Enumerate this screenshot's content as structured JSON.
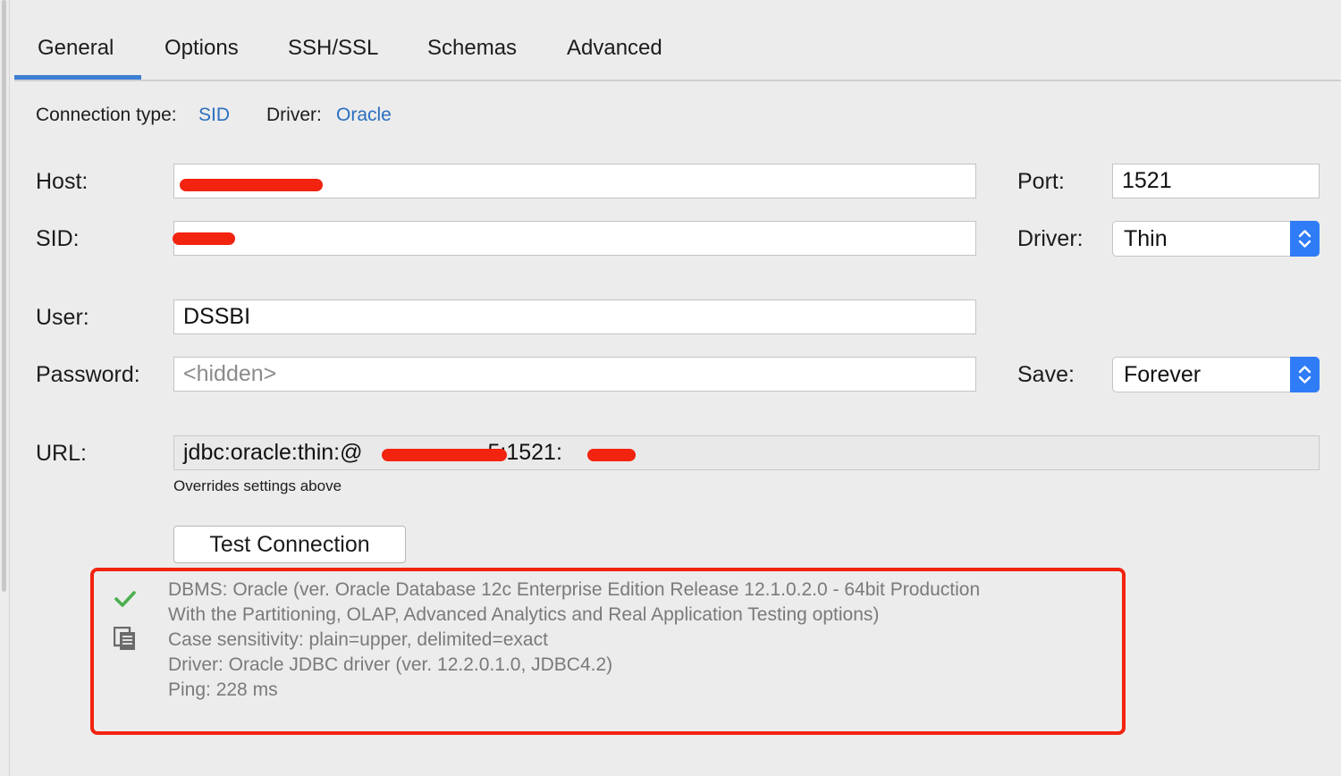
{
  "tabs": [
    "General",
    "Options",
    "SSH/SSL",
    "Schemas",
    "Advanced"
  ],
  "active_tab": "General",
  "connection": {
    "type_label": "Connection type:",
    "type_value": "SID",
    "driver_label": "Driver:",
    "driver_value": "Oracle"
  },
  "form": {
    "host_label": "Host:",
    "port_label": "Port:",
    "port_value": "1521",
    "sid_label": "SID:",
    "driver_label": "Driver:",
    "driver_value": "Thin",
    "user_label": "User:",
    "user_value": "DSSBI",
    "password_label": "Password:",
    "password_placeholder": "<hidden>",
    "save_label": "Save:",
    "save_value": "Forever",
    "url_label": "URL:",
    "url_prefix": "jdbc:oracle:thin:@",
    "url_mid": "5:1521:",
    "url_hint": "Overrides settings above"
  },
  "test_button": "Test Connection",
  "result": {
    "lines": [
      "DBMS: Oracle (ver. Oracle Database 12c Enterprise Edition Release 12.1.0.2.0 - 64bit Production",
      "With the Partitioning, OLAP, Advanced Analytics and Real Application Testing options)",
      "Case sensitivity: plain=upper, delimited=exact",
      "Driver: Oracle JDBC driver (ver. 12.2.0.1.0, JDBC4.2)",
      "Ping: 228 ms"
    ],
    "success_color": "#4caf50",
    "highlight_color": "#f2230f"
  },
  "colors": {
    "accent": "#3d7fd1",
    "link": "#2a6fc1",
    "stepper": "#2f7cf6"
  }
}
